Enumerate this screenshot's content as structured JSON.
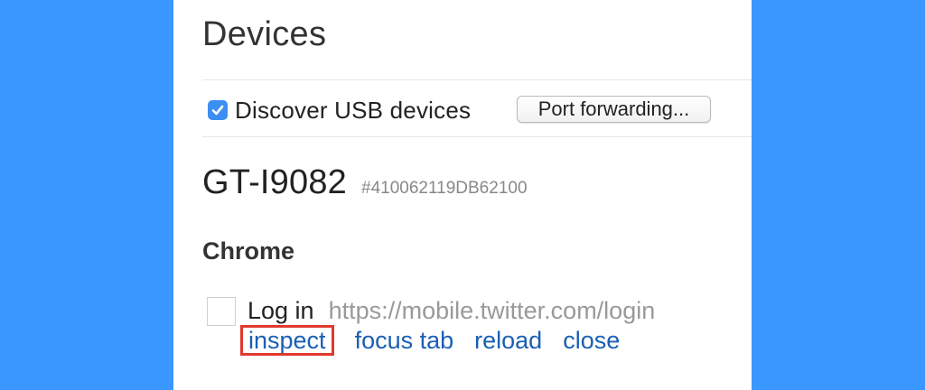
{
  "page": {
    "title": "Devices"
  },
  "discover": {
    "label": "Discover USB devices",
    "checked": true,
    "port_forwarding_label": "Port forwarding..."
  },
  "device": {
    "name": "GT-I9082",
    "serial": "#410062119DB62100",
    "browser": {
      "name": "Chrome",
      "targets": [
        {
          "title": "Log in",
          "url": "https://mobile.twitter.com/login",
          "actions": {
            "inspect": "inspect",
            "focus_tab": "focus tab",
            "reload": "reload",
            "close": "close"
          }
        }
      ]
    }
  },
  "colors": {
    "background": "#3a97ff",
    "link": "#1a5fb4",
    "highlight_border": "#e2382d",
    "checkbox_accent": "#3b8ff3"
  }
}
